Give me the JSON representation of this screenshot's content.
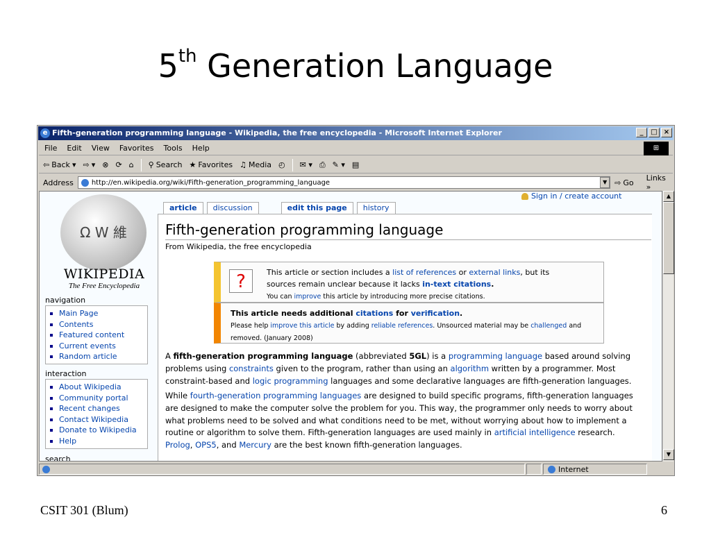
{
  "slide": {
    "title_main": "5",
    "title_sup": "th",
    "title_rest": " Generation Language",
    "footer_left": "CSIT 301 (Blum)",
    "footer_right": "6"
  },
  "window": {
    "title": "Fifth-generation programming language - Wikipedia, the free encyclopedia - Microsoft Internet Explorer",
    "controls": {
      "minimize": "_",
      "maximize": "□",
      "close": "×"
    },
    "menu": [
      "File",
      "Edit",
      "View",
      "Favorites",
      "Tools",
      "Help"
    ],
    "toolbar": {
      "back": "Back",
      "search": "Search",
      "favorites": "Favorites",
      "media": "Media"
    },
    "address_label": "Address",
    "address_value": "http://en.wikipedia.org/wiki/Fifth-generation_programming_language",
    "go_label": "Go",
    "links_label": "Links",
    "status_zone": "Internet"
  },
  "sidebar": {
    "logo_word": "WIKIPEDIA",
    "logo_tagline": "The Free Encyclopedia",
    "navigation_title": "navigation",
    "navigation": [
      "Main Page",
      "Contents",
      "Featured content",
      "Current events",
      "Random article"
    ],
    "interaction_title": "interaction",
    "interaction": [
      "About Wikipedia",
      "Community portal",
      "Recent changes",
      "Contact Wikipedia",
      "Donate to Wikipedia",
      "Help"
    ],
    "search_title": "search"
  },
  "page": {
    "signin": "Sign in / create account",
    "tabs": [
      "article",
      "discussion",
      "edit this page",
      "history"
    ],
    "title": "Fifth-generation programming language",
    "subtitle": "From Wikipedia, the free encyclopedia",
    "box1": {
      "line1_a": "This article or section includes a ",
      "line1_link1": "list of references",
      "line1_b": " or ",
      "line1_link2": "external links",
      "line1_c": ", but its",
      "line2_a": "sources remain unclear because it lacks ",
      "line2_link": "in-text citations",
      "line2_b": ".",
      "line3_a": "You can ",
      "line3_link": "improve",
      "line3_b": " this article by introducing more precise citations."
    },
    "box2": {
      "line1_a": "This article needs additional ",
      "line1_link1": "citations",
      "line1_b": " for ",
      "line1_link2": "verification",
      "line1_c": ".",
      "line2_a": "Please help ",
      "line2_link1": "improve this article",
      "line2_b": " by adding ",
      "line2_link2": "reliable references",
      "line2_c": ". Unsourced material may be ",
      "line2_link3": "challenged",
      "line2_d": " and",
      "line3": "removed. (January 2008)"
    },
    "para1": {
      "a": "A ",
      "b": "fifth-generation programming language",
      "c": " (abbreviated ",
      "d": "5GL",
      "e": ") is a ",
      "f": "programming language",
      "g": " based around solving",
      "h": "problems using ",
      "i": "constraints",
      "j": " given to the program, rather than using an ",
      "k": "algorithm",
      "l": " written by a programmer. Most",
      "m": "constraint-based and ",
      "n": "logic programming",
      "o": " languages and some declarative languages are fifth-generation languages."
    },
    "para2": {
      "a": "While ",
      "b": "fourth-generation programming languages",
      "c": " are designed to build specific programs, fifth-generation languages",
      "d": "are designed to make the computer solve the problem for you. This way, the programmer only needs to worry about",
      "e": "what problems need to be solved and what conditions need to be met, without worrying about how to implement a",
      "f": "routine or algorithm to solve them. Fifth-generation languages are used mainly in ",
      "g": "artificial intelligence",
      "h": " research.",
      "i": "Prolog",
      "j": ", ",
      "k": "OPS5",
      "l": ", and ",
      "m": "Mercury",
      "n": " are the best known fifth-generation languages."
    }
  }
}
